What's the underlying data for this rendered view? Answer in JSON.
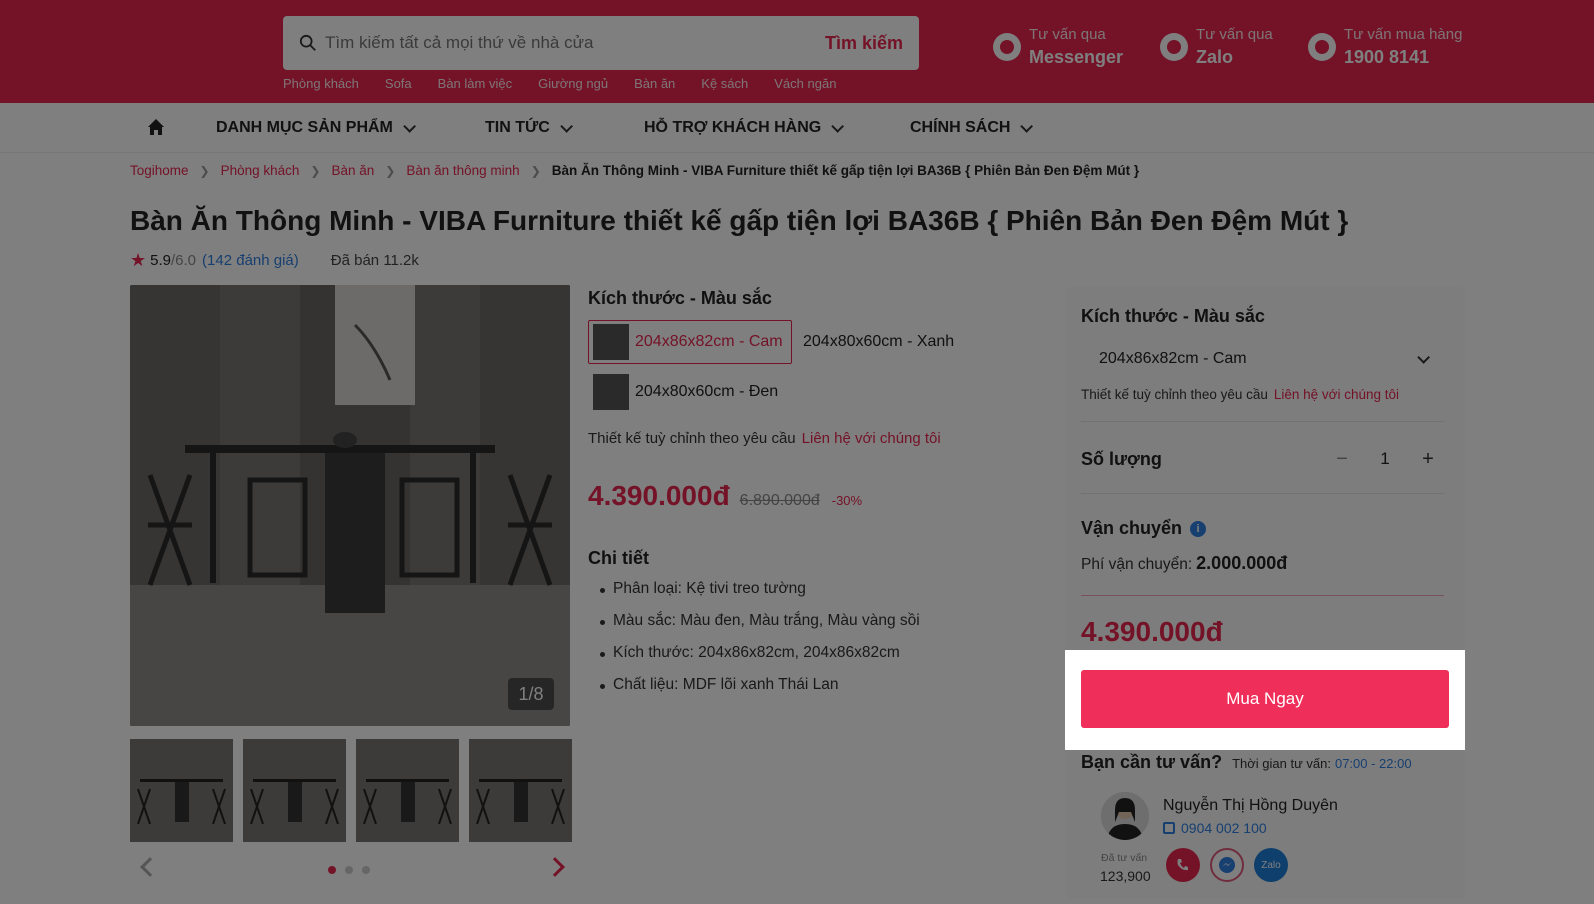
{
  "header": {
    "search_placeholder": "Tìm kiếm tất cả mọi thứ về nhà cửa",
    "search_button": "Tìm kiếm",
    "quick_links": [
      "Phòng khách",
      "Sofa",
      "Bàn làm việc",
      "Giường ngủ",
      "Bàn ăn",
      "Kệ sách",
      "Vách ngăn"
    ],
    "contacts": [
      {
        "small": "Tư vấn qua",
        "big": "Messenger",
        "icon": "messenger-icon"
      },
      {
        "small": "Tư vấn qua",
        "big": "Zalo",
        "icon": "zalo-icon"
      },
      {
        "small": "Tư vấn mua hàng",
        "big": "1900 8141",
        "icon": "phone-icon"
      }
    ],
    "brand_color": "#e8264f"
  },
  "nav": {
    "items": [
      "DANH MỤC SẢN PHẨM",
      "TIN TỨC",
      "HỖ TRỢ KHÁCH HÀNG",
      "CHÍNH SÁCH"
    ]
  },
  "breadcrumb": [
    "Togihome",
    "Phòng khách",
    "Bàn ăn",
    "Bàn ăn thông minh",
    "Bàn Ăn Thông Minh - VIBA Furniture thiết kế gấp tiện lợi BA36B { Phiên Bản Đen Đệm Mút }"
  ],
  "product": {
    "title": "Bàn Ăn Thông Minh - VIBA Furniture thiết kế gấp tiện lợi BA36B { Phiên Bản Đen Đệm Mút }",
    "rating": "5.9",
    "rating_max": "/6.0",
    "reviews": "(142 đánh giá)",
    "sold": "Đã bán 11.2k",
    "image_counter": "1/8",
    "gallery_dots": 3,
    "variant_heading": "Kích thước - Màu sắc",
    "variants": [
      "204x86x82cm - Cam",
      "204x80x60cm - Xanh",
      "204x80x60cm - Đen"
    ],
    "selected_variant": 0,
    "custom_text": "Thiết kế tuỳ chỉnh theo yêu cầu",
    "custom_link": "Liên hệ với chúng tôi",
    "price": "4.390.000đ",
    "old_price": "6.890.000đ",
    "discount": "-30%",
    "detail_heading": "Chi tiết",
    "details": [
      "Phân loại: Kệ tivi treo tường",
      "Màu sắc: Màu đen, Màu trắng, Màu vàng sồi",
      "Kích thước: 204x86x82cm, 204x86x82cm",
      "Chất liệu: MDF lõi xanh Thái Lan"
    ]
  },
  "buybox": {
    "heading": "Kích thước - Màu sắc",
    "selected": "204x86x82cm - Cam",
    "custom_text": "Thiết kế tuỳ chỉnh theo yêu cầu",
    "custom_link": "Liên hệ với chúng tôi",
    "qty_label": "Số lượng",
    "qty_minus": "−",
    "qty_value": "1",
    "qty_plus": "+",
    "ship_label": "Vận chuyển",
    "ship_info": "i",
    "ship_fee_label": "Phí vận chuyển:",
    "ship_fee": "2.000.000đ",
    "total": "4.390.000đ",
    "buy_button": "Mua Ngay",
    "advice_title": "Bạn cần tư vấn?",
    "advice_time_label": "Thời gian tư vấn:",
    "advice_time": "07:00 - 22:00",
    "agent_name": "Nguyễn Thị Hồng Duyên",
    "agent_phone": "0904 002 100",
    "served_label": "Đã tư vấn",
    "served_count": "123,900",
    "zalo_label": "Zalo"
  }
}
